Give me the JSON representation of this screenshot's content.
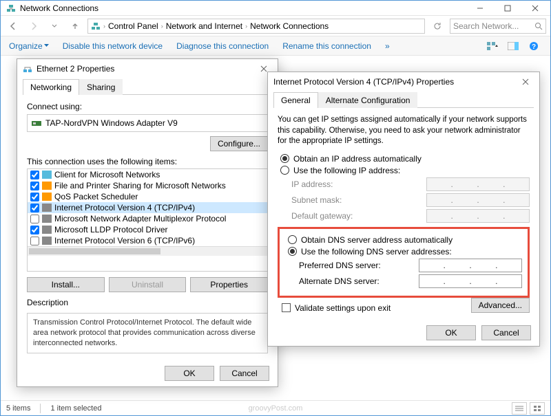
{
  "explorer": {
    "title": "Network Connections",
    "breadcrumb": [
      "Control Panel",
      "Network and Internet",
      "Network Connections"
    ],
    "search_placeholder": "Search Network...",
    "toolbar": {
      "organize": "Organize",
      "disable": "Disable this network device",
      "diagnose": "Diagnose this connection",
      "rename": "Rename this connection"
    },
    "status": {
      "items": "5 items",
      "selected": "1 item selected"
    },
    "watermark": "groovyPost.com"
  },
  "eth": {
    "title": "Ethernet 2 Properties",
    "tabs": {
      "networking": "Networking",
      "sharing": "Sharing"
    },
    "connect_using": "Connect using:",
    "adapter": "TAP-NordVPN Windows Adapter V9",
    "configure": "Configure...",
    "uses_label": "This connection uses the following items:",
    "items": [
      {
        "label": "Client for Microsoft Networks",
        "checked": true
      },
      {
        "label": "File and Printer Sharing for Microsoft Networks",
        "checked": true
      },
      {
        "label": "QoS Packet Scheduler",
        "checked": true
      },
      {
        "label": "Internet Protocol Version 4 (TCP/IPv4)",
        "checked": true,
        "selected": true
      },
      {
        "label": "Microsoft Network Adapter Multiplexor Protocol",
        "checked": false
      },
      {
        "label": "Microsoft LLDP Protocol Driver",
        "checked": true
      },
      {
        "label": "Internet Protocol Version 6 (TCP/IPv6)",
        "checked": false
      }
    ],
    "buttons": {
      "install": "Install...",
      "uninstall": "Uninstall",
      "properties": "Properties"
    },
    "description_label": "Description",
    "description": "Transmission Control Protocol/Internet Protocol. The default wide area network protocol that provides communication across diverse interconnected networks.",
    "ok": "OK",
    "cancel": "Cancel"
  },
  "ipv4": {
    "title": "Internet Protocol Version 4 (TCP/IPv4) Properties",
    "tabs": {
      "general": "General",
      "alt": "Alternate Configuration"
    },
    "intro": "You can get IP settings assigned automatically if your network supports this capability. Otherwise, you need to ask your network administrator for the appropriate IP settings.",
    "ip_auto": "Obtain an IP address automatically",
    "ip_manual": "Use the following IP address:",
    "ip_address": "IP address:",
    "subnet": "Subnet mask:",
    "gateway": "Default gateway:",
    "dns_auto": "Obtain DNS server address automatically",
    "dns_manual": "Use the following DNS server addresses:",
    "pref_dns": "Preferred DNS server:",
    "alt_dns": "Alternate DNS server:",
    "validate": "Validate settings upon exit",
    "advanced": "Advanced...",
    "ok": "OK",
    "cancel": "Cancel"
  }
}
